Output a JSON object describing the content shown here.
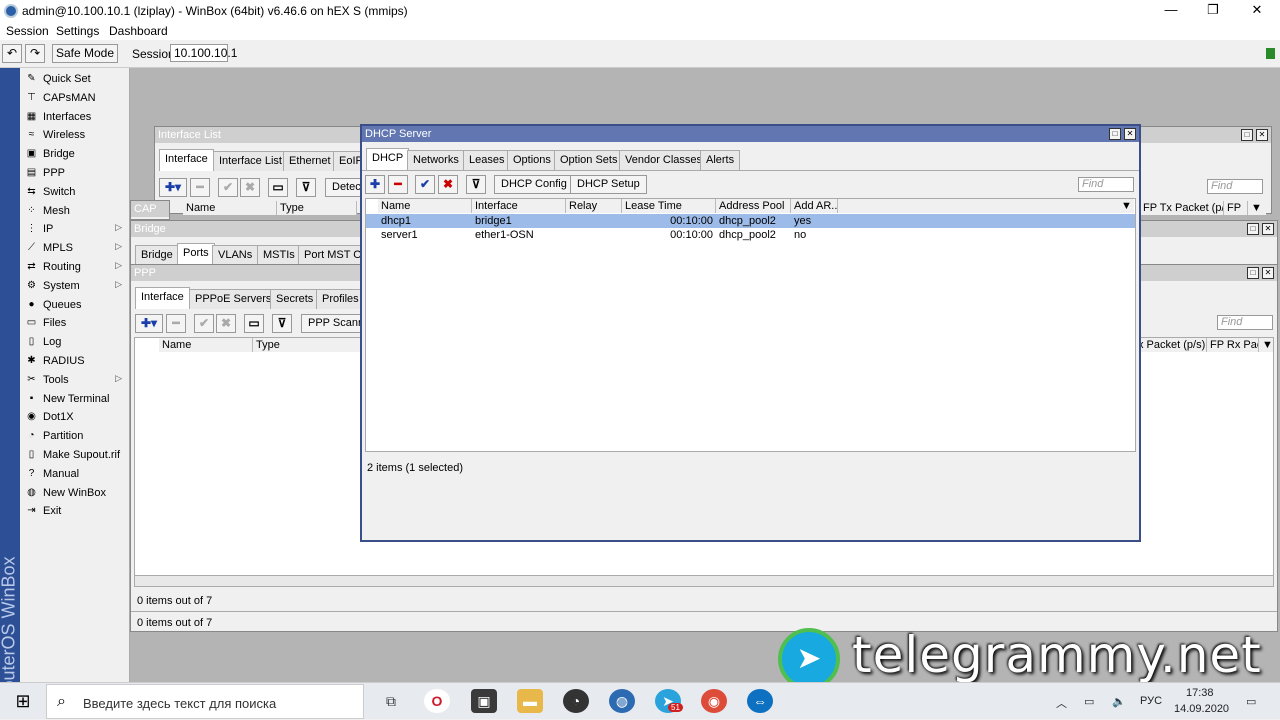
{
  "titlebar": {
    "title": "admin@10.100.10.1 (lziplay) - WinBox (64bit) v6.46.6 on hEX S (mmips)",
    "minimize": "—",
    "maximize": "❐",
    "close": "✕"
  },
  "menubar": {
    "session": "Session",
    "settings": "Settings",
    "dashboard": "Dashboard"
  },
  "toolbar": {
    "undo_icon": "↶",
    "redo_icon": "↷",
    "safe_mode": "Safe Mode",
    "session_label": "Session:",
    "session_value": "10.100.10.1"
  },
  "vstrip": {
    "text": "RouterOS WinBox"
  },
  "sidebar": {
    "items": [
      {
        "label": "Quick Set",
        "icon": "✎",
        "arrow": ""
      },
      {
        "label": "CAPsMAN",
        "icon": "⊤",
        "arrow": ""
      },
      {
        "label": "Interfaces",
        "icon": "▦",
        "arrow": ""
      },
      {
        "label": "Wireless",
        "icon": "≈",
        "arrow": ""
      },
      {
        "label": "Bridge",
        "icon": "▣",
        "arrow": ""
      },
      {
        "label": "PPP",
        "icon": "▤",
        "arrow": ""
      },
      {
        "label": "Switch",
        "icon": "⇆",
        "arrow": ""
      },
      {
        "label": "Mesh",
        "icon": "⁘",
        "arrow": ""
      },
      {
        "label": "IP",
        "icon": "⋮",
        "arrow": "▷"
      },
      {
        "label": "MPLS",
        "icon": "⟋",
        "arrow": "▷"
      },
      {
        "label": "Routing",
        "icon": "⇄",
        "arrow": "▷"
      },
      {
        "label": "System",
        "icon": "⚙",
        "arrow": "▷"
      },
      {
        "label": "Queues",
        "icon": "●",
        "arrow": ""
      },
      {
        "label": "Files",
        "icon": "▭",
        "arrow": ""
      },
      {
        "label": "Log",
        "icon": "▯",
        "arrow": ""
      },
      {
        "label": "RADIUS",
        "icon": "✱",
        "arrow": ""
      },
      {
        "label": "Tools",
        "icon": "✂",
        "arrow": "▷"
      },
      {
        "label": "New Terminal",
        "icon": "▪",
        "arrow": ""
      },
      {
        "label": "Dot1X",
        "icon": "◉",
        "arrow": ""
      },
      {
        "label": "Partition",
        "icon": "◔",
        "arrow": ""
      },
      {
        "label": "Make Supout.rif",
        "icon": "▯",
        "arrow": ""
      },
      {
        "label": "Manual",
        "icon": "?",
        "arrow": ""
      },
      {
        "label": "New WinBox",
        "icon": "◍",
        "arrow": ""
      },
      {
        "label": "Exit",
        "icon": "⇥",
        "arrow": ""
      }
    ]
  },
  "interface_list": {
    "title": "Interface List",
    "tabs": [
      "Interface",
      "Interface List",
      "Ethernet",
      "EoIP"
    ],
    "detect_btn": "Detec",
    "cols": [
      "Name",
      "Type"
    ],
    "find": "Find",
    "right_cols": [
      "FP Tx Packet (p/s)",
      "FP"
    ]
  },
  "cap_window": {
    "title": "CAP"
  },
  "bridge_window": {
    "title": "Bridge",
    "tabs": [
      "Bridge",
      "Ports",
      "VLANs",
      "MSTIs",
      "Port MST Ov"
    ]
  },
  "ppp_window": {
    "title": "PPP",
    "tabs": [
      "Interface",
      "PPPoE Servers",
      "Secrets",
      "Profiles"
    ],
    "scanner_btn": "PPP Scann",
    "cols": [
      "Name",
      "Type"
    ],
    "find": "Find",
    "right_cols": [
      "x Packet (p/s)",
      "FP Rx Pac"
    ],
    "status": "0 items out of 7",
    "status2": "0 items out of 7"
  },
  "dhcp_window": {
    "title": "DHCP Server",
    "tabs": [
      "DHCP",
      "Networks",
      "Leases",
      "Options",
      "Option Sets",
      "Vendor Classes",
      "Alerts"
    ],
    "buttons": {
      "add": "✚",
      "remove": "━",
      "enable": "✔",
      "disable": "✖",
      "filter": "⊽",
      "config": "DHCP Config",
      "setup": "DHCP Setup"
    },
    "find": "Find",
    "columns": [
      "Name",
      "Interface",
      "Relay",
      "Lease Time",
      "Address Pool",
      "Add AR..."
    ],
    "rows": [
      {
        "name": "dhcp1",
        "interface": "bridge1",
        "relay": "",
        "lease": "00:10:00",
        "pool": "dhcp_pool2",
        "arp": "yes",
        "selected": true
      },
      {
        "name": "server1",
        "interface": "ether1-OSN",
        "relay": "",
        "lease": "00:10:00",
        "pool": "dhcp_pool2",
        "arp": "no",
        "selected": false
      }
    ],
    "status": "2 items (1 selected)"
  },
  "taskbar": {
    "search_placeholder": "Введите здесь текст для поиска",
    "lang": "РУС",
    "time": "17:38",
    "date": "14.09.2020",
    "badge": "51"
  },
  "watermark": {
    "text": "telegrammy.net"
  },
  "colors": {
    "active_title": "#6277b1",
    "selected_row": "#9dbbe8",
    "strip": "#2c4f96"
  }
}
